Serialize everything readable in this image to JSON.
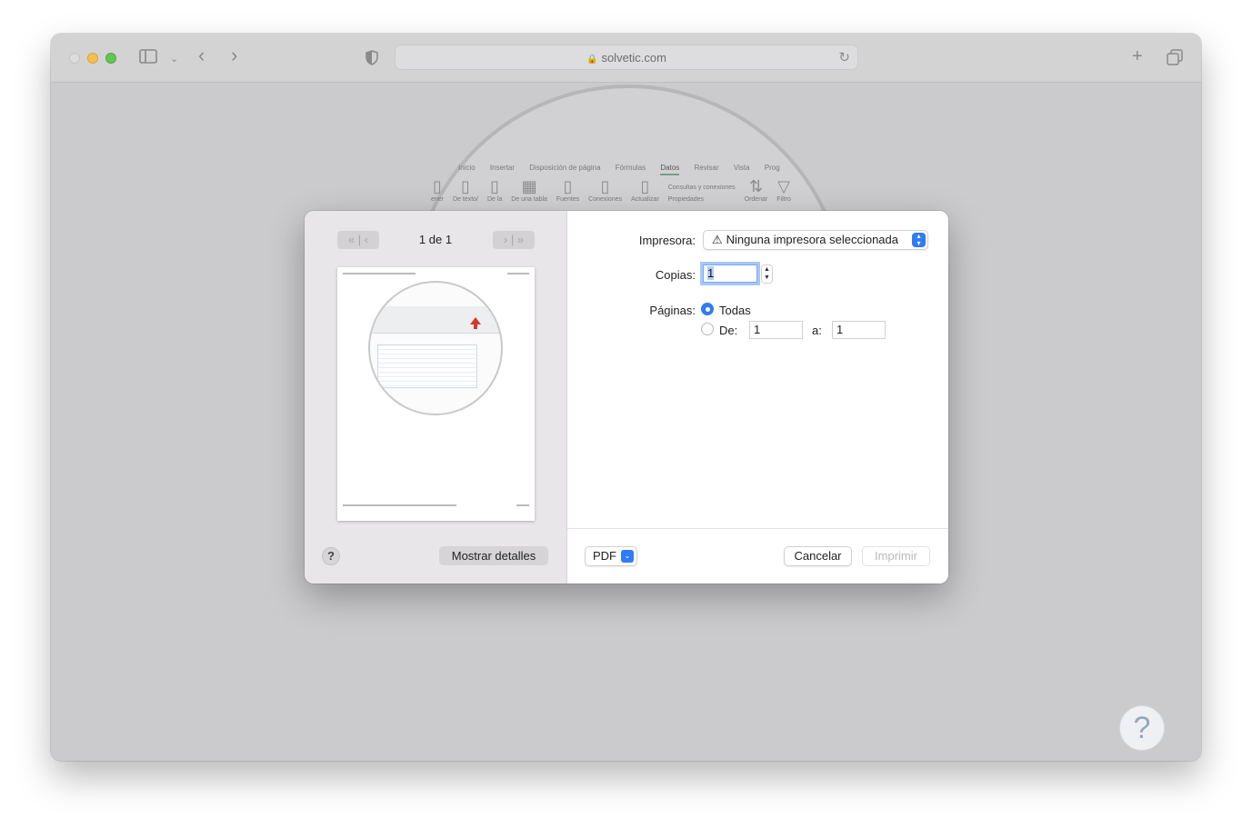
{
  "browser": {
    "url": "solvetic.com",
    "icons": {
      "sidebar": "sidebar-icon",
      "chevron": "chevron-down-icon",
      "back": "back-icon",
      "forward": "forward-icon",
      "shield": "shield-icon",
      "reload": "reload-icon",
      "new_tab": "plus-icon",
      "tabs": "tabs-icon"
    }
  },
  "background_page": {
    "ribbon_tabs": [
      "Inicio",
      "Insertar",
      "Disposición de página",
      "Fórmulas",
      "Datos",
      "Revisar",
      "Vista",
      "Prog"
    ],
    "active_tab": "Datos",
    "ribbon_items": [
      "ener",
      "De texto/",
      "De la",
      "De una tabla",
      "Fuentes",
      "Conexiones",
      "Actualizar",
      "Consultas y conexiones",
      "Propiedades",
      "Ordenar",
      "Filtro"
    ]
  },
  "print_dialog": {
    "page_counter": "1 de 1",
    "printer_label": "Impresora:",
    "printer_value": "Ninguna impresora seleccionada",
    "copies_label": "Copias:",
    "copies_value": "1",
    "pages_label": "Páginas:",
    "pages_all": "Todas",
    "pages_from_label": "De:",
    "pages_from_value": "1",
    "pages_to_label": "a:",
    "pages_to_value": "1",
    "help_label": "?",
    "show_details_label": "Mostrar detalles",
    "pdf_label": "PDF",
    "cancel_label": "Cancelar",
    "print_label": "Imprimir",
    "colors": {
      "accent": "#2f7cf6",
      "sidebar_bg": "#e8e6e9",
      "disabled_text": "#b8b8b8"
    }
  }
}
